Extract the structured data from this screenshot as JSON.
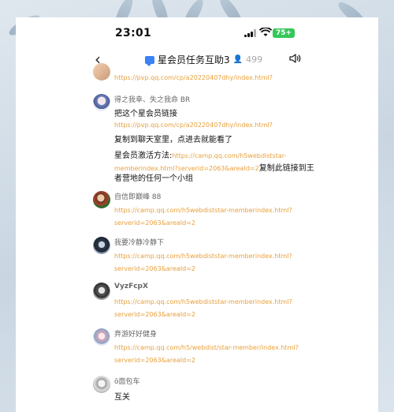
{
  "status": {
    "time": "23:01",
    "battery": "75+"
  },
  "nav": {
    "title": "星会员任务互助3",
    "member_count": "499"
  },
  "messages": [
    {
      "link": "https://pvp.qq.com/cp/a20220407dhy/index.html?"
    },
    {
      "sender": "得之我幸、失之我命 BR",
      "text1": "把这个星会员链接",
      "link1": "https://pvp.qq.com/cp/a20220407dhy/index.html?",
      "text2": "复制到聊天室里，点进去就能看了",
      "text3": "星会员激活方法:",
      "link2a": "https://camp.qq.com/h5webdiststar-",
      "link2b": "memberindex.html?serverid=2063&areaId=2",
      "text4": "复制此链接到王",
      "text5": "者营地的任何一个小组"
    },
    {
      "sender": "自信即巅峰 88",
      "link_a": "https://camp.qq.com/h5webdiststar-memberindex.html?",
      "link_b": "serverid=2063&areaId=2"
    },
    {
      "sender": "我要冷静冷静下",
      "link_a": "https://camp.qq.com/h5webdiststar-memberindex.html?",
      "link_b": "serverid=2063&areaId=2"
    },
    {
      "sender": "VyzFcpX",
      "link_a": "https://camp.qq.com/h5webdiststar-memberindex.html?",
      "link_b": "serverid=2063&areaId=2"
    },
    {
      "sender": "弃游好好健身",
      "link_a": "https://camp.qq.com/h5/webdist/star-member/index.html?",
      "link_b": "serverid=2063&areaId=2"
    },
    {
      "sender": "ō面包车",
      "text": "互关"
    }
  ]
}
